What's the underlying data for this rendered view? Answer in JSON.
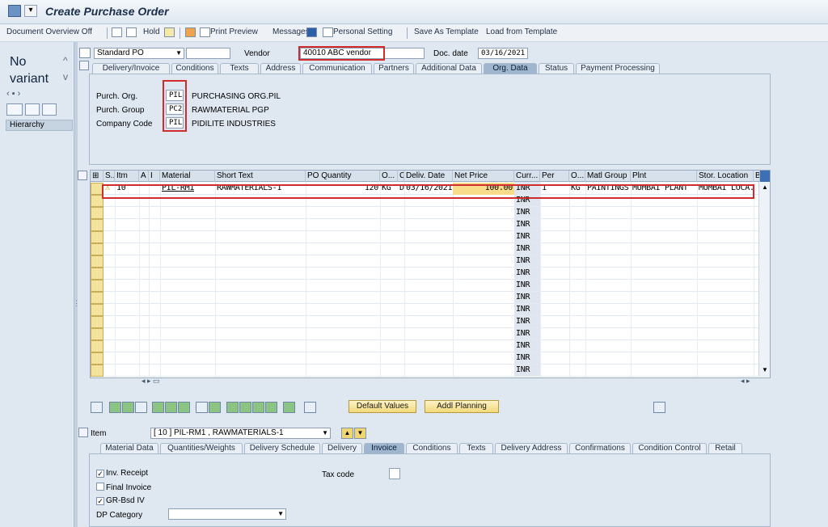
{
  "window": {
    "title": "Create Purchase Order"
  },
  "toolbar": {
    "doc_overview": "Document Overview Off",
    "hold": "Hold",
    "print_preview": "Print Preview",
    "messages": "Messages",
    "personal_setting": "Personal Setting",
    "save_template": "Save As Template",
    "load_template": "Load from Template"
  },
  "left_pane": {
    "no_variant": "No variant",
    "hierarchy": "Hierarchy"
  },
  "header": {
    "po_type": "Standard PO",
    "vendor_label": "Vendor",
    "vendor_value": "40010 ABC vendor",
    "docdate_label": "Doc. date",
    "docdate_value": "03/16/2021",
    "tabs": [
      "Delivery/Invoice",
      "Conditions",
      "Texts",
      "Address",
      "Communication",
      "Partners",
      "Additional Data",
      "Org. Data",
      "Status",
      "Payment Processing"
    ],
    "active_tab": "Org. Data",
    "org": {
      "purch_org_label": "Purch. Org.",
      "purch_org_code": "PIL",
      "purch_org_name": "PURCHASING ORG.PIL",
      "purch_group_label": "Purch. Group",
      "purch_group_code": "PC2",
      "purch_group_name": "RAWMATERIAL PGP",
      "company_label": "Company Code",
      "company_code": "PIL",
      "company_name": "PIDILITE INDUSTRIES"
    }
  },
  "items_table": {
    "columns": [
      "S..",
      "Itm",
      "A",
      "I",
      "Material",
      "Short Text",
      "PO Quantity",
      "O...",
      "C",
      "Deliv. Date",
      "Net Price",
      "Curr...",
      "Per",
      "O...",
      "Matl Group",
      "Plnt",
      "Stor. Location",
      "B"
    ],
    "row": {
      "itm": "10",
      "material": "PIL-RM1",
      "short_text": "RAWMATERIALS-1",
      "po_qty": "120",
      "uom": "KG",
      "c": "D",
      "deliv_date": "03/16/2021",
      "net_price": "100.00",
      "curr": "INR",
      "per": "1",
      "order_unit": "KG",
      "matl_group": "PAINTINGS",
      "plant": "MUMBAI PLANT",
      "stor_loc": "MUMBAI LOCA..."
    },
    "empty_curr": "INR"
  },
  "actions": {
    "default_values": "Default Values",
    "addl_planning": "Addl Planning"
  },
  "item_detail": {
    "label": "Item",
    "selected": "[ 10 ] PIL-RM1 , RAWMATERIALS-1",
    "tabs": [
      "Material Data",
      "Quantities/Weights",
      "Delivery Schedule",
      "Delivery",
      "Invoice",
      "Conditions",
      "Texts",
      "Delivery Address",
      "Confirmations",
      "Condition Control",
      "Retail"
    ],
    "active_tab": "Invoice",
    "inv_receipt": "Inv. Receipt",
    "final_invoice": "Final Invoice",
    "gr_bsd_iv": "GR-Bsd IV",
    "dp_category": "DP Category",
    "tax_code": "Tax code"
  }
}
